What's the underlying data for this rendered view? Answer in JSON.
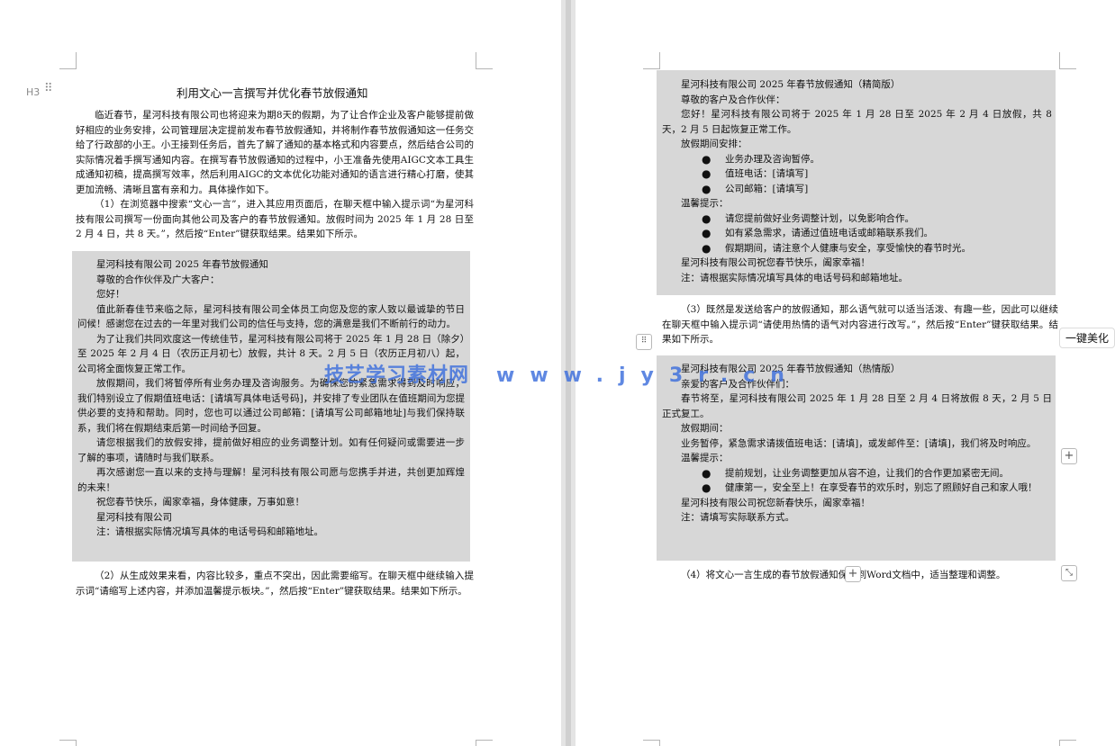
{
  "left_page": {
    "title": "利用文心一言撰写并优化春节放假通知",
    "heading_tag": "H3",
    "drag_handle_glyph": "⠿",
    "intro": "临近春节，星河科技有限公司也将迎来为期8天的假期，为了让合作企业及客户能够提前做好相应的业务安排，公司管理层决定提前发布春节放假通知，并将制作春节放假通知这一任务交给了行政部的小王。小王接到任务后，首先了解了通知的基本格式和内容要点，然后结合公司的实际情况着手撰写通知内容。在撰写春节放假通知的过程中，小王准备先使用AIGC文本工具生成通知初稿，提高撰写效率，然后利用AIGC的文本优化功能对通知的语言进行精心打磨，使其更加流畅、清晰且富有亲和力。具体操作如下。",
    "step1": "（1）在浏览器中搜索“文心一言”，进入其应用页面后，在聊天框中输入提示词“为星河科技有限公司撰写一份面向其他公司及客户的春节放假通知。放假时间为 2025 年 1 月 28 日至 2 月 4 日，共 8 天。”，然后按“Enter”键获取结果。结果如下所示。",
    "box": [
      "星河科技有限公司 2025 年春节放假通知",
      "尊敬的合作伙伴及广大客户：",
      "您好！",
      "值此新春佳节来临之际，星河科技有限公司全体员工向您及您的家人致以最诚挚的节日问候！感谢您在过去的一年里对我们公司的信任与支持，您的满意是我们不断前行的动力。",
      "为了让我们共同欢度这一传统佳节，星河科技有限公司将于 2025 年 1 月 28 日（除夕）至 2025 年 2 月 4 日（农历正月初七）放假，共计 8 天。2 月 5 日（农历正月初八）起，公司将全面恢复正常工作。",
      "放假期间，我们将暂停所有业务办理及咨询服务。为确保您的紧急需求得到及时响应，我们特别设立了假期值班电话：[请填写具体电话号码]，并安排了专业团队在值班期间为您提供必要的支持和帮助。同时，您也可以通过公司邮箱：[请填写公司邮箱地址]与我们保持联系，我们将在假期结束后第一时间给予回复。",
      "请您根据我们的放假安排，提前做好相应的业务调整计划。如有任何疑问或需要进一步了解的事项，请随时与我们联系。",
      "再次感谢您一直以来的支持与理解！星河科技有限公司愿与您携手并进，共创更加辉煌的未来！",
      "祝您春节快乐，阖家幸福，身体健康，万事如意！",
      "星河科技有限公司",
      "注：请根据实际情况填写具体的电话号码和邮箱地址。"
    ],
    "step2": "（2）从生成效果来看，内容比较多，重点不突出，因此需要缩写。在聊天框中继续输入提示词“请缩写上述内容，并添加温馨提示板块。”，然后按“Enter”键获取结果。结果如下所示。"
  },
  "right_page": {
    "box1": {
      "title": "星河科技有限公司 2025 年春节放假通知（精简版）",
      "greeting": "尊敬的客户及合作伙伴：",
      "body": "您好！星河科技有限公司将于 2025 年 1 月 28 日至 2025 年 2 月 4 日放假，共 8 天，2 月 5 日起恢复正常工作。",
      "arrangement_label": "放假期间安排：",
      "arrangement": [
        "业务办理及咨询暂停。",
        "值班电话：[请填写]",
        "公司邮箱：[请填写]"
      ],
      "tips_label": "温馨提示：",
      "tips": [
        "请您提前做好业务调整计划，以免影响合作。",
        "如有紧急需求，请通过值班电话或邮箱联系我们。",
        "假期期间，请注意个人健康与安全，享受愉快的春节时光。"
      ],
      "closing": "星河科技有限公司祝您春节快乐，阖家幸福！",
      "note": "注：请根据实际情况填写具体的电话号码和邮箱地址。"
    },
    "step3": "（3）既然是发送给客户的放假通知，那么语气就可以适当活泼、有趣一些，因此可以继续在聊天框中输入提示词“请使用热情的语气对内容进行改写。”，然后按“Enter”键获取结果。结果如下所示。",
    "box2": {
      "title": "星河科技有限公司 2025 年春节放假通知（热情版）",
      "greeting": "亲爱的客户及合作伙伴们：",
      "body": "春节将至，星河科技有限公司 2025 年 1 月 28 日至 2 月 4 日将放假 8 天，2 月 5 日正式复工。",
      "period_label": "放假期间：",
      "period": "业务暂停，紧急需求请拨值班电话：[请填]，或发邮件至：[请填]，我们将及时响应。",
      "tips_label": "温馨提示：",
      "tips": [
        "提前规划，让业务调整更加从容不迫，让我们的合作更加紧密无间。",
        "健康第一，安全至上！在享受春节的欢乐时，别忘了照顾好自己和家人哦！"
      ],
      "closing": "星河科技有限公司祝您新春快乐，阖家幸福！",
      "note": "注：请填写实际联系方式。"
    },
    "step4": "（4）将文心一言生成的春节放假通知保存到Word文档中，适当整理和调整。"
  },
  "watermark": {
    "text": "技艺学习素材网",
    "url": "www.jy3r.cn"
  },
  "toolbar": {
    "beautify_label": "一键美化",
    "plus_glyph": "+",
    "drag_glyph": "⠿",
    "resize_glyph": "⤡"
  },
  "bullet_glyph": "●"
}
